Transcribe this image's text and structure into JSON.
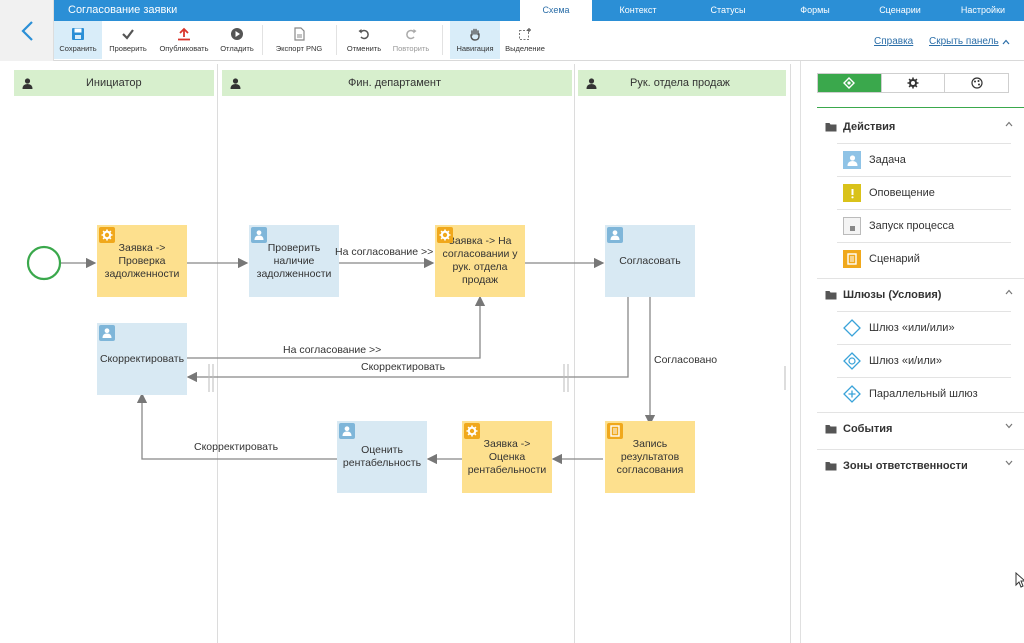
{
  "app": {
    "title": "Согласование заявки"
  },
  "top_tabs": [
    "Схема",
    "Контекст",
    "Статусы",
    "Формы",
    "Сценарии",
    "Настройки"
  ],
  "toolbar": {
    "save": "Сохранить",
    "check": "Проверить",
    "publish": "Опубликовать",
    "debug": "Отладить",
    "export": "Экспорт PNG",
    "undo": "Отменить",
    "redo": "Повторить",
    "navigation": "Навигация",
    "selection": "Выделение",
    "help": "Справка",
    "hide_panel": "Скрыть панель"
  },
  "lanes": [
    "Инициатор",
    "Фин. департамент",
    "Рук. отдела продаж"
  ],
  "nodes": {
    "check_debt_script": "Заявка -> Проверка задолженности",
    "check_debt_task": "Проверить наличие задолженности",
    "to_head_script": "Заявка -> На согласовании у рук. отдела продаж",
    "approve_task": "Согласовать",
    "correct_task": "Скорректировать",
    "record_results": "Запись результатов согласования",
    "profit_script": "Заявка -> Оценка рентабельности",
    "profit_task": "Оценить рентабельность"
  },
  "flow_labels": {
    "to_approval_1": "На согласование >>",
    "to_approval_2": "На согласование >>",
    "correct_1": "Скорректировать",
    "approved": "Согласовано",
    "correct_2": "Скорректировать"
  },
  "panel": {
    "groups": {
      "actions": "Действия",
      "gateways": "Шлюзы (Условия)",
      "events": "События",
      "zones": "Зоны ответственности"
    },
    "actions": [
      "Задача",
      "Оповещение",
      "Запуск процесса",
      "Сценарий"
    ],
    "gateways": [
      "Шлюз «или/или»",
      "Шлюз «и/или»",
      "Параллельный шлюз"
    ]
  },
  "colors": {
    "accent": "#2b8fd6",
    "lane": "#d7efcd",
    "task": "#d8e9f3",
    "script": "#fde08e",
    "green": "#3aa84c"
  }
}
